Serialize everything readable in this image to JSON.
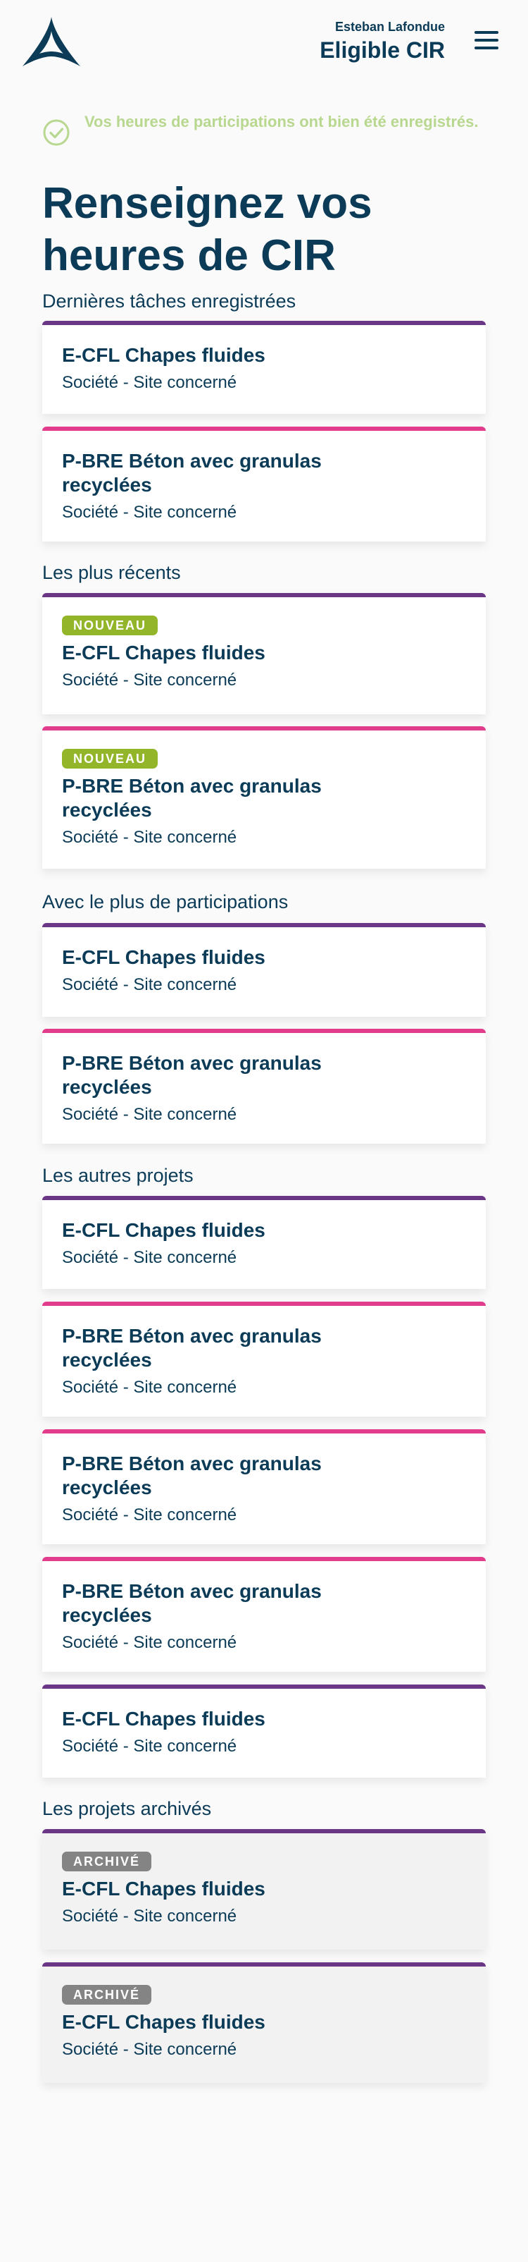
{
  "header": {
    "user_name": "Esteban Lafondue",
    "user_status": "Eligible CIR"
  },
  "alert": {
    "message": "Vos heures de participations ont bien été enregistrés."
  },
  "page_title": "Renseignez vos heures de CIR",
  "colors": {
    "primary": "#0b3b57",
    "purple_accent": "#6b3685",
    "pink_accent": "#e23d8c",
    "success": "#b8d78f",
    "badge_new": "#93b52a",
    "badge_archived": "#848484"
  },
  "sections": {
    "recent_tasks": "Dernières tâches enregistrées",
    "most_recent": "Les plus récents",
    "most_participations": "Avec le plus de participations",
    "other_projects": "Les autres projets",
    "archived_projects": "Les projets archivés"
  },
  "cards": [
    {
      "title": "E-CFL Chapes fluides",
      "subtitle": "Société - Site concerné",
      "badge": ""
    },
    {
      "title": "P-BRE Béton avec granulas recyclées",
      "subtitle": "Société - Site concerné",
      "badge": ""
    },
    {
      "title": "E-CFL Chapes fluides",
      "subtitle": "Société - Site concerné",
      "badge": "NOUVEAU"
    },
    {
      "title": "P-BRE Béton avec granulas recyclées",
      "subtitle": "Société - Site concerné",
      "badge": "NOUVEAU"
    },
    {
      "title": "E-CFL Chapes fluides",
      "subtitle": "Société - Site concerné",
      "badge": ""
    },
    {
      "title": "P-BRE Béton avec granulas recyclées",
      "subtitle": "Société - Site concerné",
      "badge": ""
    },
    {
      "title": "E-CFL Chapes fluides",
      "subtitle": "Société - Site concerné",
      "badge": ""
    },
    {
      "title": "P-BRE Béton avec granulas recyclées",
      "subtitle": "Société - Site concerné",
      "badge": ""
    },
    {
      "title": "P-BRE Béton avec granulas recyclées",
      "subtitle": "Société - Site concerné",
      "badge": ""
    },
    {
      "title": "P-BRE Béton avec granulas recyclées",
      "subtitle": "Société - Site concerné",
      "badge": ""
    },
    {
      "title": "E-CFL Chapes fluides",
      "subtitle": "Société - Site concerné",
      "badge": ""
    },
    {
      "title": "E-CFL Chapes fluides",
      "subtitle": "Société - Site concerné",
      "badge": "ARCHIVÉ"
    },
    {
      "title": "E-CFL Chapes fluides",
      "subtitle": "Société - Site concerné",
      "badge": "ARCHIVÉ"
    }
  ]
}
